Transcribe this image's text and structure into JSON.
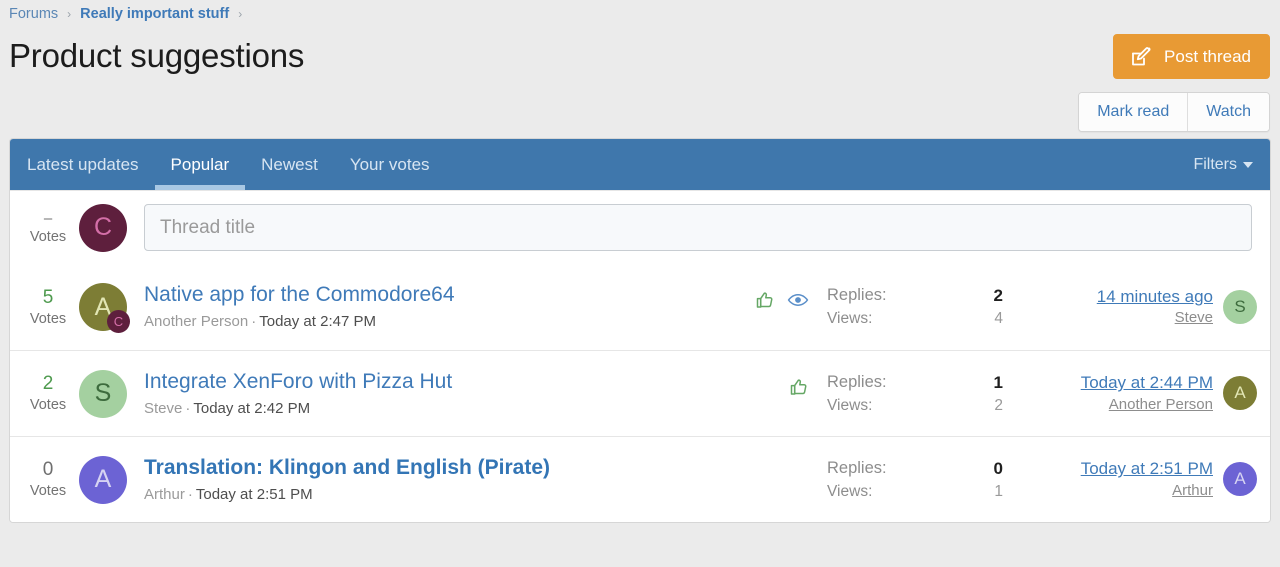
{
  "breadcrumb": {
    "items": [
      {
        "label": "Forums",
        "strong": false
      },
      {
        "label": "Really important stuff",
        "strong": true
      }
    ],
    "separator": "›"
  },
  "header": {
    "title": "Product suggestions",
    "post_thread_label": "Post thread",
    "post_thread_icon": "pencil-square-icon",
    "post_thread_color": "#e89a34",
    "mark_read_label": "Mark read",
    "watch_label": "Watch"
  },
  "tabs": {
    "items": [
      {
        "label": "Latest updates",
        "active": false
      },
      {
        "label": "Popular",
        "active": true
      },
      {
        "label": "Newest",
        "active": false
      },
      {
        "label": "Your votes",
        "active": false
      }
    ],
    "filters_label": "Filters",
    "filters_icon": "chevron-down-icon",
    "bar_color": "#3f77ac",
    "active_underline_color": "#a8c8e4"
  },
  "search_row": {
    "votes_count": "–",
    "votes_label": "Votes",
    "avatar": {
      "initial": "C",
      "color": "#5e1f3d",
      "text_color": "#d46fa8"
    },
    "input_placeholder": "Thread title",
    "input_value": ""
  },
  "threads": [
    {
      "votes_count": "5",
      "votes_label": "Votes",
      "votes_style": "positive",
      "avatar": {
        "initial": "A",
        "color": "#7d7d35",
        "text_color": "#e2e6b4"
      },
      "avatar_badge": {
        "initial": "C",
        "color": "#5e1f3d",
        "text_color": "#d46fa8"
      },
      "title": "Native app for the Commodore64",
      "unread": false,
      "author": "Another Person",
      "date": "Today at 2:47 PM",
      "icons": [
        "thumbs-up-icon",
        "eye-icon"
      ],
      "replies_label": "Replies:",
      "replies_count": "2",
      "views_label": "Views:",
      "views_count": "4",
      "last_date": "14 minutes ago",
      "last_user": "Steve",
      "last_avatar": {
        "initial": "S",
        "color": "#a4d0a0",
        "text_color": "#3d6b3d"
      }
    },
    {
      "votes_count": "2",
      "votes_label": "Votes",
      "votes_style": "positive",
      "avatar": {
        "initial": "S",
        "color": "#a4d0a0",
        "text_color": "#3d6b3d"
      },
      "avatar_badge": null,
      "title": "Integrate XenForo with Pizza Hut",
      "unread": false,
      "author": "Steve",
      "date": "Today at 2:42 PM",
      "icons": [
        "thumbs-up-icon"
      ],
      "replies_label": "Replies:",
      "replies_count": "1",
      "views_label": "Views:",
      "views_count": "2",
      "last_date": "Today at 2:44 PM",
      "last_user": "Another Person",
      "last_avatar": {
        "initial": "A",
        "color": "#7d7d35",
        "text_color": "#e2e6b4"
      }
    },
    {
      "votes_count": "0",
      "votes_label": "Votes",
      "votes_style": "zero",
      "avatar": {
        "initial": "A",
        "color": "#6c63d4",
        "text_color": "#d6d3f2"
      },
      "avatar_badge": null,
      "title": "Translation: Klingon and English (Pirate)",
      "unread": true,
      "author": "Arthur",
      "date": "Today at 2:51 PM",
      "icons": [],
      "replies_label": "Replies:",
      "replies_count": "0",
      "views_label": "Views:",
      "views_count": "1",
      "last_date": "Today at 2:51 PM",
      "last_user": "Arthur",
      "last_avatar": {
        "initial": "A",
        "color": "#6c63d4",
        "text_color": "#d6d3f2"
      }
    }
  ]
}
